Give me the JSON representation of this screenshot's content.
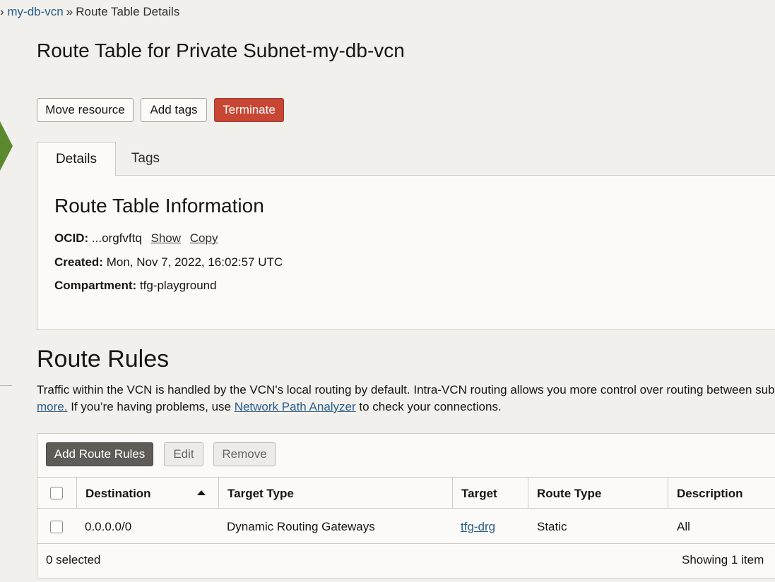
{
  "breadcrumb": {
    "parent_label": "my-db-vcn",
    "separator": "»",
    "current_label": "Route Table Details"
  },
  "page_title": "Route Table for Private Subnet-my-db-vcn",
  "actions": {
    "move_resource": "Move resource",
    "add_tags": "Add tags",
    "terminate": "Terminate"
  },
  "tabs": [
    {
      "label": "Details",
      "active": true
    },
    {
      "label": "Tags",
      "active": false
    }
  ],
  "info": {
    "title": "Route Table Information",
    "ocid_label": "OCID:",
    "ocid_value": "...orgfvftq",
    "show_label": "Show",
    "copy_label": "Copy",
    "created_label": "Created:",
    "created_value": "Mon, Nov 7, 2022, 16:02:57 UTC",
    "compartment_label": "Compartment:",
    "compartment_value": "tfg-playground"
  },
  "route_rules": {
    "title": "Route Rules",
    "description_line1": "Traffic within the VCN is handled by the VCN's local routing by default. Intra-VCN routing allows you more control over routing between subr",
    "learn_more": "more.",
    "description_line2_mid": " If you’re having problems, use ",
    "network_path_analyzer": "Network Path Analyzer",
    "description_line2_end": " to check your connections.",
    "buttons": {
      "add": "Add Route Rules",
      "edit": "Edit",
      "remove": "Remove"
    },
    "columns": [
      "Destination",
      "Target Type",
      "Target",
      "Route Type",
      "Description"
    ],
    "rows": [
      {
        "destination": "0.0.0.0/0",
        "target_type": "Dynamic Routing Gateways",
        "target": "tfg-drg",
        "route_type": "Static",
        "description": "All"
      }
    ],
    "selected_text": "0 selected",
    "showing_text": "Showing 1 item"
  },
  "colors": {
    "accent_link": "#2a5d8a",
    "danger": "#c74634",
    "side_arrow": "#5b8a2e"
  },
  "icons": [
    "sort-ascending-icon",
    "side-arrow-icon"
  ]
}
